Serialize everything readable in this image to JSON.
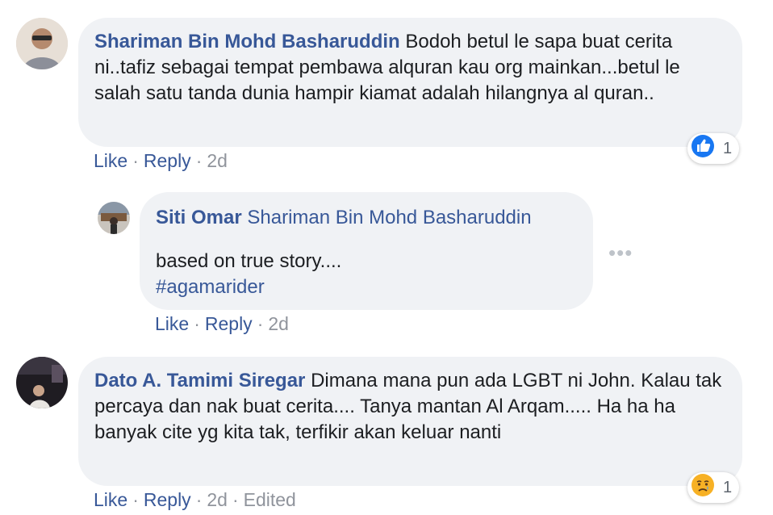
{
  "comments": [
    {
      "author": "Shariman Bin Mohd Basharuddin",
      "text": " Bodoh betul le sapa buat cerita ni..tafiz sebagai tempat pembawa alquran kau org mainkan...betul le salah satu tanda dunia hampir kiamat adalah hilangnya al quran..",
      "actions": {
        "like": "Like",
        "reply": "Reply",
        "time": "2d"
      },
      "reaction": {
        "type": "like-icon",
        "count": "1",
        "color": "#1877f2"
      }
    },
    {
      "author": "Siti Omar",
      "mention": "Shariman Bin Mohd Basharuddin",
      "text": "based on true story....",
      "hashtag": "#agamarider",
      "actions": {
        "like": "Like",
        "reply": "Reply",
        "time": "2d"
      }
    },
    {
      "author": "Dato A. Tamimi Siregar",
      "text": " Dimana mana pun ada LGBT ni John. Kalau tak percaya dan nak buat cerita.... Tanya mantan Al Arqam..... Ha ha ha banyak cite yg kita tak, terfikir akan keluar nanti",
      "actions": {
        "like": "Like",
        "reply": "Reply",
        "time": "2d",
        "edited": "Edited"
      },
      "reaction": {
        "type": "sad-emoji-icon",
        "count": "1",
        "color": "#f7b125"
      }
    }
  ],
  "more_icon": "more-options-icon",
  "colors": {
    "link": "#385898",
    "bubble": "#f0f2f5",
    "meta": "#90949c"
  }
}
